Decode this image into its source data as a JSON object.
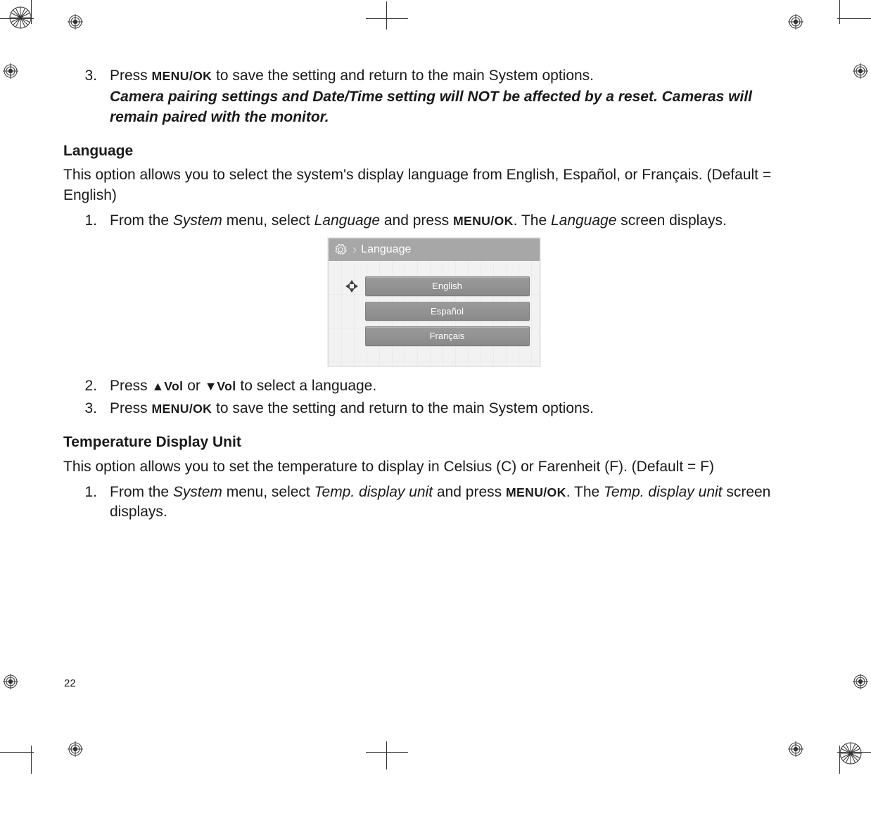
{
  "page_number": "22",
  "section1": {
    "step3_num": "3.",
    "step3_pre": "Press ",
    "step3_btn": "MENU/OK",
    "step3_post": " to save the setting and return to the main System options.",
    "note": "Camera pairing settings and Date/Time setting will NOT be affected by a reset. Cameras will remain paired with the monitor."
  },
  "language_section": {
    "heading": "Language",
    "intro": "This option allows you to select the system's display language from English, Español, or Français. (Default = English)",
    "step1": {
      "num": "1.",
      "t1": "From the ",
      "system": "System",
      "t2": " menu, select ",
      "lang1": "Language",
      "t3": " and press ",
      "btn": "MENU/OK",
      "t4": ". The ",
      "lang2": "Language",
      "t5": " screen displays."
    },
    "screenshot": {
      "title": "Language",
      "options": [
        "English",
        "Español",
        "Français"
      ]
    },
    "step2": {
      "num": "2.",
      "t1": "Press ",
      "up": "▲",
      "vol1": "Vol",
      "t2": " or ",
      "dn": "▼",
      "vol2": "Vol",
      "t3": " to select a language."
    },
    "step3": {
      "num": "3.",
      "t1": "Press ",
      "btn": "MENU/OK",
      "t2": " to save the setting and return to the main System options."
    }
  },
  "temp_section": {
    "heading": "Temperature Display Unit",
    "intro": "This option allows you to set the temperature to display in Celsius (C) or Farenheit (F). (Default = F)",
    "step1": {
      "num": "1.",
      "t1": "From the ",
      "system": "System",
      "t2": " menu, select ",
      "tdu1": "Temp. display unit",
      "t3": " and press ",
      "btn": "MENU/OK",
      "t4": ". The ",
      "tdu2": "Temp. display unit",
      "t5": " screen displays."
    }
  }
}
